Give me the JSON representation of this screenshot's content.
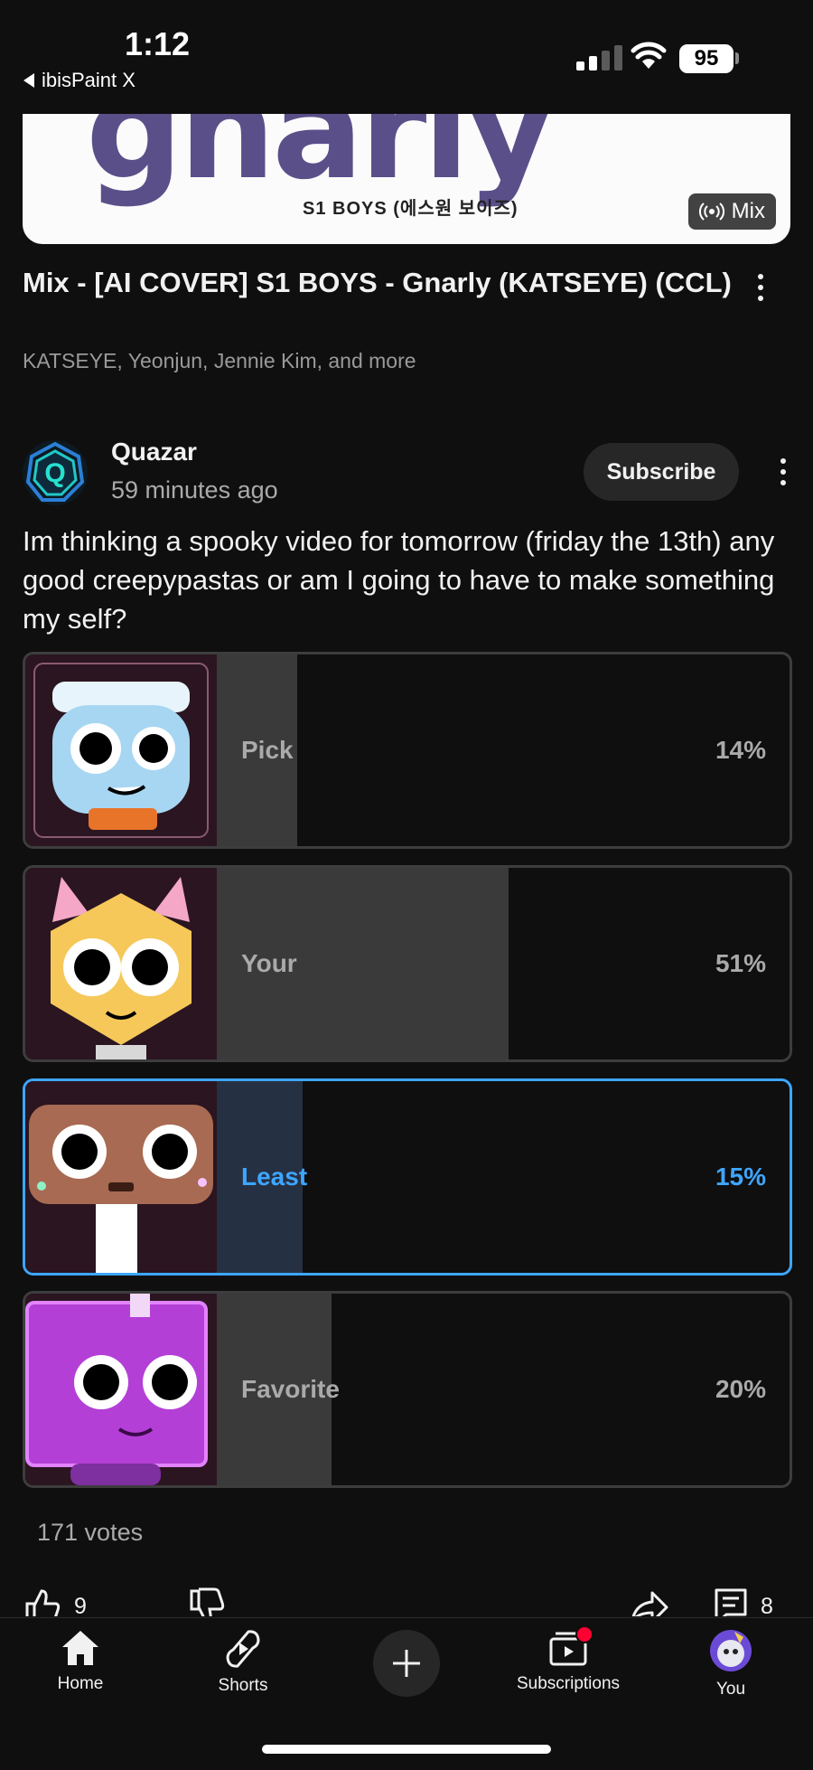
{
  "status_bar": {
    "time": "1:12",
    "back_app": "ibisPaint X",
    "battery": "95"
  },
  "thumbnail": {
    "title_art": "gnarly",
    "subtitle": "S1 BOYS (에스원 보이즈)",
    "badge": "Mix"
  },
  "video": {
    "title": "Mix - [AI COVER] S1 BOYS - Gnarly (KATSEYE) (CCL)",
    "subtitle": "KATSEYE, Yeonjun, Jennie Kim, and more"
  },
  "post": {
    "author": "Quazar",
    "time_ago": "59 minutes ago",
    "subscribe_label": "Subscribe",
    "text": "Im thinking a spooky video for tomorrow (friday the 13th) any good creepypastas or am I going to have to make something my self?"
  },
  "poll": {
    "options": [
      {
        "label": "Pick",
        "percent_text": "14%",
        "percent": 14,
        "selected": false,
        "image_icon": "blue-cartoon-character-icon"
      },
      {
        "label": "Your",
        "percent_text": "51%",
        "percent": 51,
        "selected": false,
        "image_icon": "yellow-cat-character-icon"
      },
      {
        "label": "Least",
        "percent_text": "15%",
        "percent": 15,
        "selected": true,
        "image_icon": "brown-character-icon"
      },
      {
        "label": "Favorite",
        "percent_text": "20%",
        "percent": 20,
        "selected": false,
        "image_icon": "purple-box-character-icon"
      }
    ],
    "votes": "171 votes"
  },
  "actions": {
    "likes": "9",
    "comments": "8"
  },
  "bottom_nav": {
    "home": "Home",
    "shorts": "Shorts",
    "subscriptions": "Subscriptions",
    "you": "You"
  },
  "colors": {
    "background": "#0f0f0f",
    "accent": "#3ea6ff",
    "notification": "#ff0033"
  }
}
